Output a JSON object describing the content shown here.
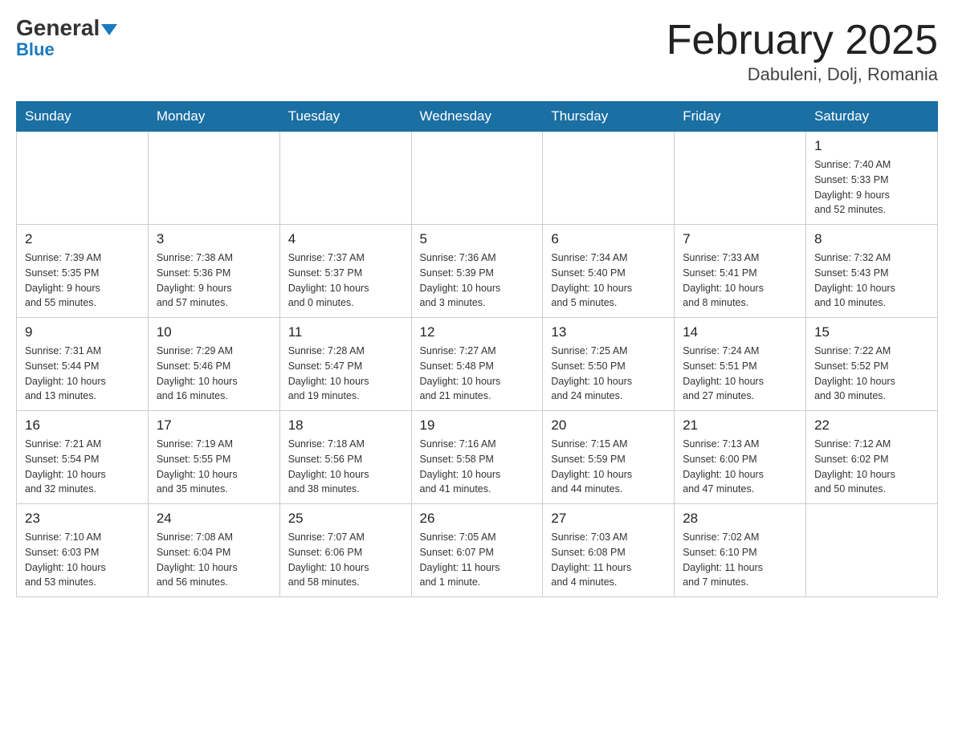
{
  "header": {
    "logo_line1": "General",
    "logo_line2": "Blue",
    "month_title": "February 2025",
    "location": "Dabuleni, Dolj, Romania"
  },
  "weekdays": [
    "Sunday",
    "Monday",
    "Tuesday",
    "Wednesday",
    "Thursday",
    "Friday",
    "Saturday"
  ],
  "weeks": [
    [
      {
        "day": "",
        "info": ""
      },
      {
        "day": "",
        "info": ""
      },
      {
        "day": "",
        "info": ""
      },
      {
        "day": "",
        "info": ""
      },
      {
        "day": "",
        "info": ""
      },
      {
        "day": "",
        "info": ""
      },
      {
        "day": "1",
        "info": "Sunrise: 7:40 AM\nSunset: 5:33 PM\nDaylight: 9 hours\nand 52 minutes."
      }
    ],
    [
      {
        "day": "2",
        "info": "Sunrise: 7:39 AM\nSunset: 5:35 PM\nDaylight: 9 hours\nand 55 minutes."
      },
      {
        "day": "3",
        "info": "Sunrise: 7:38 AM\nSunset: 5:36 PM\nDaylight: 9 hours\nand 57 minutes."
      },
      {
        "day": "4",
        "info": "Sunrise: 7:37 AM\nSunset: 5:37 PM\nDaylight: 10 hours\nand 0 minutes."
      },
      {
        "day": "5",
        "info": "Sunrise: 7:36 AM\nSunset: 5:39 PM\nDaylight: 10 hours\nand 3 minutes."
      },
      {
        "day": "6",
        "info": "Sunrise: 7:34 AM\nSunset: 5:40 PM\nDaylight: 10 hours\nand 5 minutes."
      },
      {
        "day": "7",
        "info": "Sunrise: 7:33 AM\nSunset: 5:41 PM\nDaylight: 10 hours\nand 8 minutes."
      },
      {
        "day": "8",
        "info": "Sunrise: 7:32 AM\nSunset: 5:43 PM\nDaylight: 10 hours\nand 10 minutes."
      }
    ],
    [
      {
        "day": "9",
        "info": "Sunrise: 7:31 AM\nSunset: 5:44 PM\nDaylight: 10 hours\nand 13 minutes."
      },
      {
        "day": "10",
        "info": "Sunrise: 7:29 AM\nSunset: 5:46 PM\nDaylight: 10 hours\nand 16 minutes."
      },
      {
        "day": "11",
        "info": "Sunrise: 7:28 AM\nSunset: 5:47 PM\nDaylight: 10 hours\nand 19 minutes."
      },
      {
        "day": "12",
        "info": "Sunrise: 7:27 AM\nSunset: 5:48 PM\nDaylight: 10 hours\nand 21 minutes."
      },
      {
        "day": "13",
        "info": "Sunrise: 7:25 AM\nSunset: 5:50 PM\nDaylight: 10 hours\nand 24 minutes."
      },
      {
        "day": "14",
        "info": "Sunrise: 7:24 AM\nSunset: 5:51 PM\nDaylight: 10 hours\nand 27 minutes."
      },
      {
        "day": "15",
        "info": "Sunrise: 7:22 AM\nSunset: 5:52 PM\nDaylight: 10 hours\nand 30 minutes."
      }
    ],
    [
      {
        "day": "16",
        "info": "Sunrise: 7:21 AM\nSunset: 5:54 PM\nDaylight: 10 hours\nand 32 minutes."
      },
      {
        "day": "17",
        "info": "Sunrise: 7:19 AM\nSunset: 5:55 PM\nDaylight: 10 hours\nand 35 minutes."
      },
      {
        "day": "18",
        "info": "Sunrise: 7:18 AM\nSunset: 5:56 PM\nDaylight: 10 hours\nand 38 minutes."
      },
      {
        "day": "19",
        "info": "Sunrise: 7:16 AM\nSunset: 5:58 PM\nDaylight: 10 hours\nand 41 minutes."
      },
      {
        "day": "20",
        "info": "Sunrise: 7:15 AM\nSunset: 5:59 PM\nDaylight: 10 hours\nand 44 minutes."
      },
      {
        "day": "21",
        "info": "Sunrise: 7:13 AM\nSunset: 6:00 PM\nDaylight: 10 hours\nand 47 minutes."
      },
      {
        "day": "22",
        "info": "Sunrise: 7:12 AM\nSunset: 6:02 PM\nDaylight: 10 hours\nand 50 minutes."
      }
    ],
    [
      {
        "day": "23",
        "info": "Sunrise: 7:10 AM\nSunset: 6:03 PM\nDaylight: 10 hours\nand 53 minutes."
      },
      {
        "day": "24",
        "info": "Sunrise: 7:08 AM\nSunset: 6:04 PM\nDaylight: 10 hours\nand 56 minutes."
      },
      {
        "day": "25",
        "info": "Sunrise: 7:07 AM\nSunset: 6:06 PM\nDaylight: 10 hours\nand 58 minutes."
      },
      {
        "day": "26",
        "info": "Sunrise: 7:05 AM\nSunset: 6:07 PM\nDaylight: 11 hours\nand 1 minute."
      },
      {
        "day": "27",
        "info": "Sunrise: 7:03 AM\nSunset: 6:08 PM\nDaylight: 11 hours\nand 4 minutes."
      },
      {
        "day": "28",
        "info": "Sunrise: 7:02 AM\nSunset: 6:10 PM\nDaylight: 11 hours\nand 7 minutes."
      },
      {
        "day": "",
        "info": ""
      }
    ]
  ]
}
